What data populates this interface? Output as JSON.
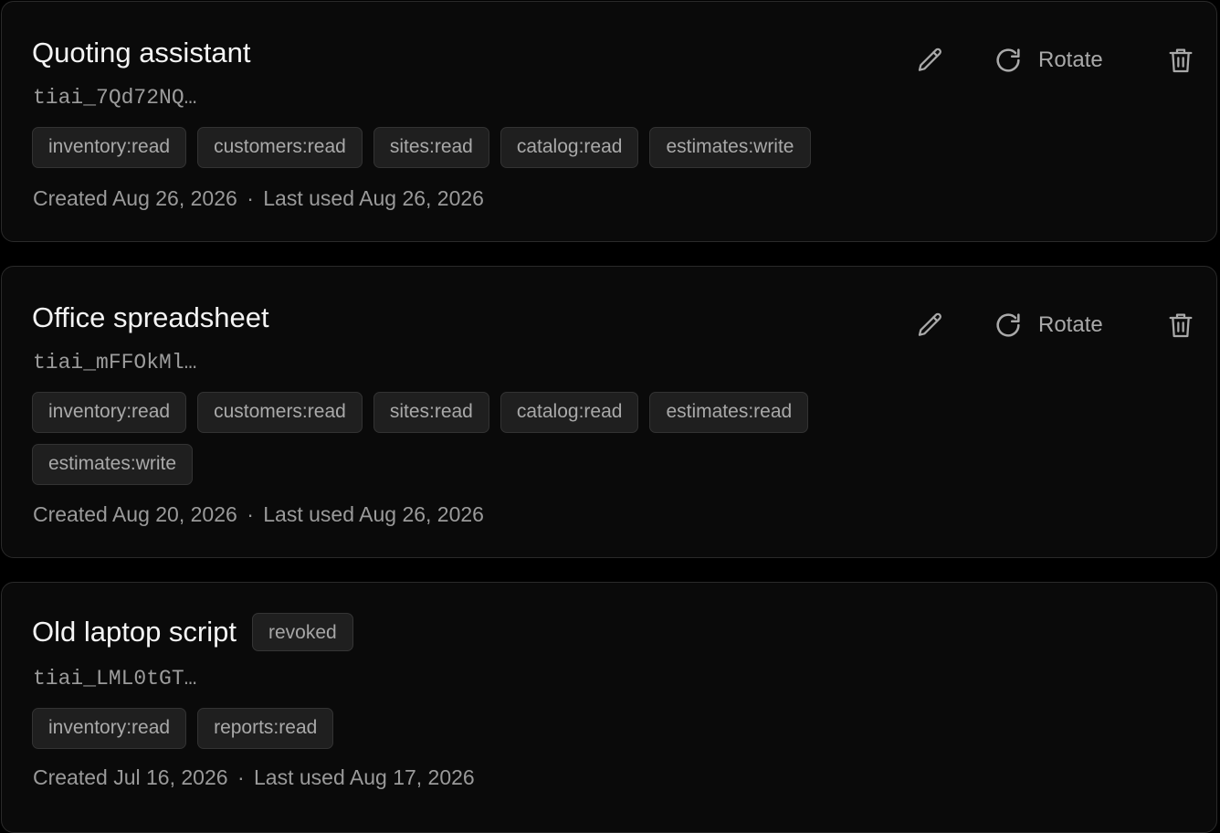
{
  "rotate_label": "Rotate",
  "created_prefix": "Created",
  "last_used_prefix": "Last used",
  "meta_separator": "·",
  "icons": {
    "edit": "pencil-icon",
    "rotate": "refresh-icon",
    "delete": "trash-icon"
  },
  "colors": {
    "background": "#000000",
    "card": "#0a0a0a",
    "tag_background": "#1f1f1f",
    "title": "#f4f4f4",
    "muted_text": "#9a9a9a"
  },
  "keys": [
    {
      "name": "Quoting assistant",
      "key_prefix": "tiai_7Qd72NQ…",
      "scopes": [
        "inventory:read",
        "customers:read",
        "sites:read",
        "catalog:read",
        "estimates:write"
      ],
      "created": "Aug 26, 2026",
      "last_used": "Aug 26, 2026"
    },
    {
      "name": "Office spreadsheet",
      "key_prefix": "tiai_mFFOkMl…",
      "scopes": [
        "inventory:read",
        "customers:read",
        "sites:read",
        "catalog:read",
        "estimates:read",
        "estimates:write"
      ],
      "created": "Aug 20, 2026",
      "last_used": "Aug 26, 2026"
    },
    {
      "name": "Old laptop script",
      "status": "revoked",
      "key_prefix": "tiai_LML0tGT…",
      "scopes": [
        "inventory:read",
        "reports:read"
      ],
      "created": "Jul 16, 2026",
      "last_used": "Aug 17, 2026"
    }
  ]
}
